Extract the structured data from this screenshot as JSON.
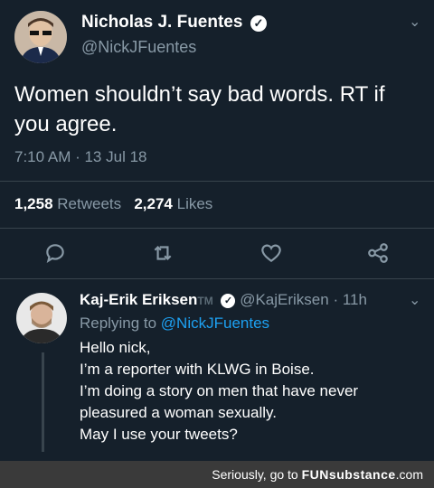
{
  "tweet": {
    "name": "Nicholas J. Fuentes",
    "handle": "@NickJFuentes",
    "text": "Women shouldn’t say bad words. RT if you agree.",
    "timestamp": "7:10 AM · 13 Jul 18",
    "retweets_count": "1,258",
    "retweets_label": "Retweets",
    "likes_count": "2,274",
    "likes_label": "Likes"
  },
  "reply": {
    "name": "Kaj-Erik Eriksen",
    "tm": "TM",
    "handle": "@KajEriksen",
    "time": "· 11h",
    "replying_prefix": "Replying to",
    "replying_handle": "@NickJFuentes",
    "lines": [
      "Hello nick,",
      "I’m a reporter with KLWG in Boise.",
      "I’m doing a story on men that have never",
      "pleasured a woman sexually.",
      "May I use your tweets?"
    ]
  },
  "footer": {
    "prefix": "Seriously, go to",
    "brand_part1": "FUN",
    "brand_part2": "substance",
    "suffix": ".com"
  },
  "colors": {
    "background": "#15202b",
    "secondary_text": "#8899a6",
    "link": "#1da1f2",
    "divider": "#38444d"
  },
  "icons": [
    "verified-badge-icon",
    "chevron-down-icon",
    "reply-icon",
    "retweet-icon",
    "like-icon",
    "share-icon"
  ]
}
